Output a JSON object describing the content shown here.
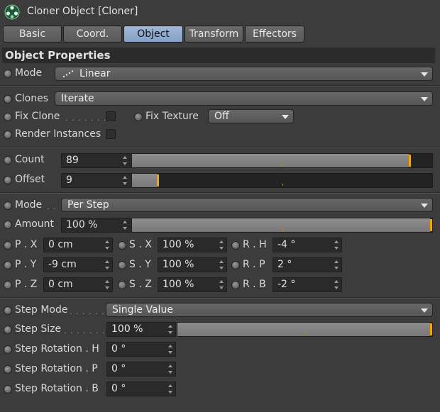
{
  "window": {
    "title": "Cloner Object [Cloner]",
    "icon": "cloner-icon"
  },
  "tabs": [
    {
      "label": "Basic",
      "active": false
    },
    {
      "label": "Coord.",
      "active": false
    },
    {
      "label": "Object",
      "active": true
    },
    {
      "label": "Transform",
      "active": false
    },
    {
      "label": "Effectors",
      "active": false
    }
  ],
  "section_title": "Object Properties",
  "mode": {
    "label": "Mode",
    "value": "Linear",
    "icon": "linear-mode-icon"
  },
  "clones": {
    "label": "Clones",
    "value": "Iterate"
  },
  "fix_clone": {
    "label": "Fix Clone",
    "dots": ". . . . . . .",
    "checked": false
  },
  "fix_texture": {
    "label": "Fix Texture",
    "value": "Off"
  },
  "render_instances": {
    "label": "Render Instances",
    "checked": false
  },
  "count": {
    "label": "Count",
    "value": "89",
    "level": 0.93
  },
  "offset": {
    "label": "Offset",
    "value": "9",
    "level": 0.09
  },
  "mode2": {
    "label": "Mode",
    "dots": ". .",
    "value": "Per Step"
  },
  "amount": {
    "label": "Amount",
    "value": "100 %",
    "level": 1.0
  },
  "position": {
    "x": {
      "label": "P . X",
      "value": "0 cm"
    },
    "y": {
      "label": "P . Y",
      "value": "-9 cm"
    },
    "z": {
      "label": "P . Z",
      "value": "0 cm"
    }
  },
  "scale": {
    "x": {
      "label": "S . X",
      "value": "100 %"
    },
    "y": {
      "label": "S . Y",
      "value": "100 %"
    },
    "z": {
      "label": "S . Z",
      "value": "100 %"
    }
  },
  "rotation": {
    "h": {
      "label": "R . H",
      "value": "-4 °"
    },
    "p": {
      "label": "R . P",
      "value": "2 °"
    },
    "b": {
      "label": "R . B",
      "value": "-2 °"
    }
  },
  "step_mode": {
    "label": "Step Mode",
    "dots": ". . . . . .",
    "value": "Single Value"
  },
  "step_size": {
    "label": "Step Size",
    "dots": ". . . . . . . .",
    "value": "100 %",
    "level": 1.0
  },
  "step_rotation_h": {
    "label": "Step Rotation . H",
    "value": "0 °"
  },
  "step_rotation_p": {
    "label": "Step Rotation . P",
    "value": "0 °"
  },
  "step_rotation_b": {
    "label": "Step Rotation . B",
    "value": "0 °"
  },
  "colors": {
    "accent_tab": "#8fa9cc",
    "slider_handle": "#f0a800",
    "background": "#3c3c3c"
  }
}
